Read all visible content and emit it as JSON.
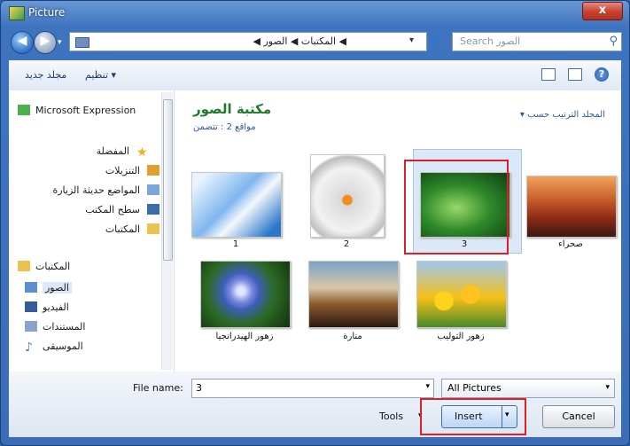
{
  "window": {
    "title": "Picture",
    "close_label": "x"
  },
  "nav": {
    "back_label": "◀",
    "forward_label": "▶",
    "history_label": "▾",
    "breadcrumb": "◀ المكتبات ◀ الصور ◀",
    "address_dropdown": "▾",
    "refresh_label": "⟳",
    "search_placeholder": "Search الصور"
  },
  "toolbar": {
    "organize": "تنظيم ▾",
    "new_folder": "مجلد جديد"
  },
  "sidebar": {
    "items": [
      {
        "label": "Microsoft Expression",
        "icon": "expression-icon",
        "color": "#4caf50"
      },
      {
        "label": "المفضلة",
        "icon": "star-icon",
        "color": "#f2b01e"
      },
      {
        "label": "التنزيلات",
        "icon": "downloads-icon",
        "color": "#e0a030"
      },
      {
        "label": "المواضع حديثة الزيارة",
        "icon": "recent-places-icon",
        "color": "#7aa7d8"
      },
      {
        "label": "سطح المكتب",
        "icon": "desktop-icon",
        "color": "#3a6ea8"
      },
      {
        "label": "المكتبات",
        "icon": "libraries-icon",
        "color": "#e9c251"
      },
      {
        "label": "المكتبات",
        "icon": "libraries-icon",
        "color": "#e9c251"
      },
      {
        "label": "الصور",
        "icon": "pictures-icon",
        "color": "#5c8fd0"
      },
      {
        "label": "الفيديو",
        "icon": "video-icon",
        "color": "#375a9a"
      },
      {
        "label": "المستندات",
        "icon": "documents-icon",
        "color": "#8aa4c8"
      },
      {
        "label": "الموسيقى",
        "icon": "music-icon",
        "color": "#4f7fc7"
      }
    ]
  },
  "library": {
    "title": "مكتبة الصور",
    "subtitle": "مواقع 2 : تتضمن",
    "arrange": "▾ المجلد الترتيب حسب"
  },
  "files": [
    {
      "name": "1",
      "thumb": "keyboard"
    },
    {
      "name": "2",
      "thumb": "printer"
    },
    {
      "name": "3",
      "thumb": "grass"
    },
    {
      "name": "صحراء",
      "thumb": "desert"
    },
    {
      "name": "زهور الهيدرانجيا",
      "thumb": "hydrangea"
    },
    {
      "name": "منارة",
      "thumb": "lighthouse"
    },
    {
      "name": "زهور التوليب",
      "thumb": "tulips"
    }
  ],
  "footer": {
    "file_name_label": "File name:",
    "file_name_value": "3",
    "filter_value": "All Pictures",
    "tools_label": "Tools",
    "insert_label": "Insert",
    "cancel_label": "Cancel",
    "dropdown_glyph": "▾"
  }
}
